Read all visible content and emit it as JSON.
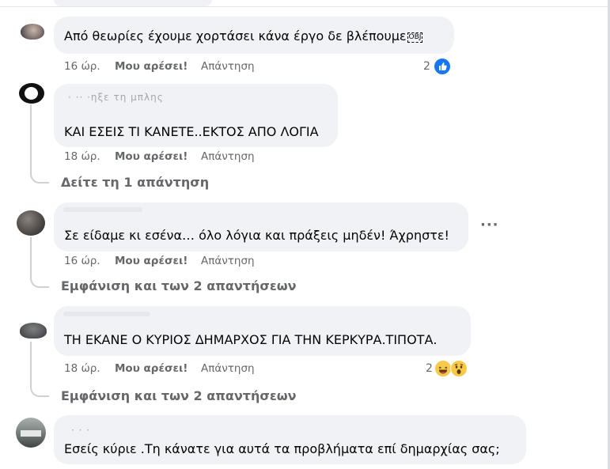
{
  "comments": [
    {
      "text": "Από θεωρίες έχουμε χορτάσει κάνα έργο δε βλέπουμε",
      "inline_token": "OBJ",
      "time": "16 ώρ.",
      "like": "Μου αρέσει!",
      "reply": "Απάντηση",
      "reactions_count": "2",
      "reactions": [
        "like-icon"
      ]
    },
    {
      "author": "· ·· ·ηξε τη μπλης",
      "text": "ΚΑΙ ΕΣΕΙΣ ΤΙ ΚΑΝΕΤΕ..ΕΚΤΟΣ ΑΠΟ ΛΟΓΙΑ",
      "time": "18 ώρ.",
      "like": "Μου αρέσει!",
      "reply": "Απάντηση",
      "replies_link": "Δείτε τη 1 απάντηση"
    },
    {
      "text": "Σε είδαμε κι εσένα… όλο λόγια και πράξεις μηδέν! Άχρηστε!",
      "time": "16 ώρ.",
      "like": "Μου αρέσει!",
      "reply": "Απάντηση",
      "replies_link": "Εμφάνιση και των 2 απαντήσεων",
      "more": "···"
    },
    {
      "text": "ΤΗ ΕΚΑΝΕ Ο ΚΥΡΙΟΣ ΔΗΜΑΡΧΟΣ ΓΙΑ ΤΗΝ ΚΕΡΚΥΡΑ.ΤΙΠΟΤΑ.",
      "time": "18 ώρ.",
      "like": "Μου αρέσει!",
      "reply": "Απάντηση",
      "reactions_count": "2",
      "reactions": [
        "haha-icon",
        "wow-icon"
      ],
      "replies_link": "Εμφάνιση και των 2 απαντήσεων"
    },
    {
      "author": "· · ·",
      "text": "Εσείς κύριε .Τη κάνατε για αυτά τα προβλήματα επί δημαρχίας σας;"
    }
  ],
  "colors": {
    "bubble": "#f0f2f5",
    "meta": "#65676b",
    "like_blue": "#1877f2",
    "emoji_yellow": "#f7c94b"
  }
}
